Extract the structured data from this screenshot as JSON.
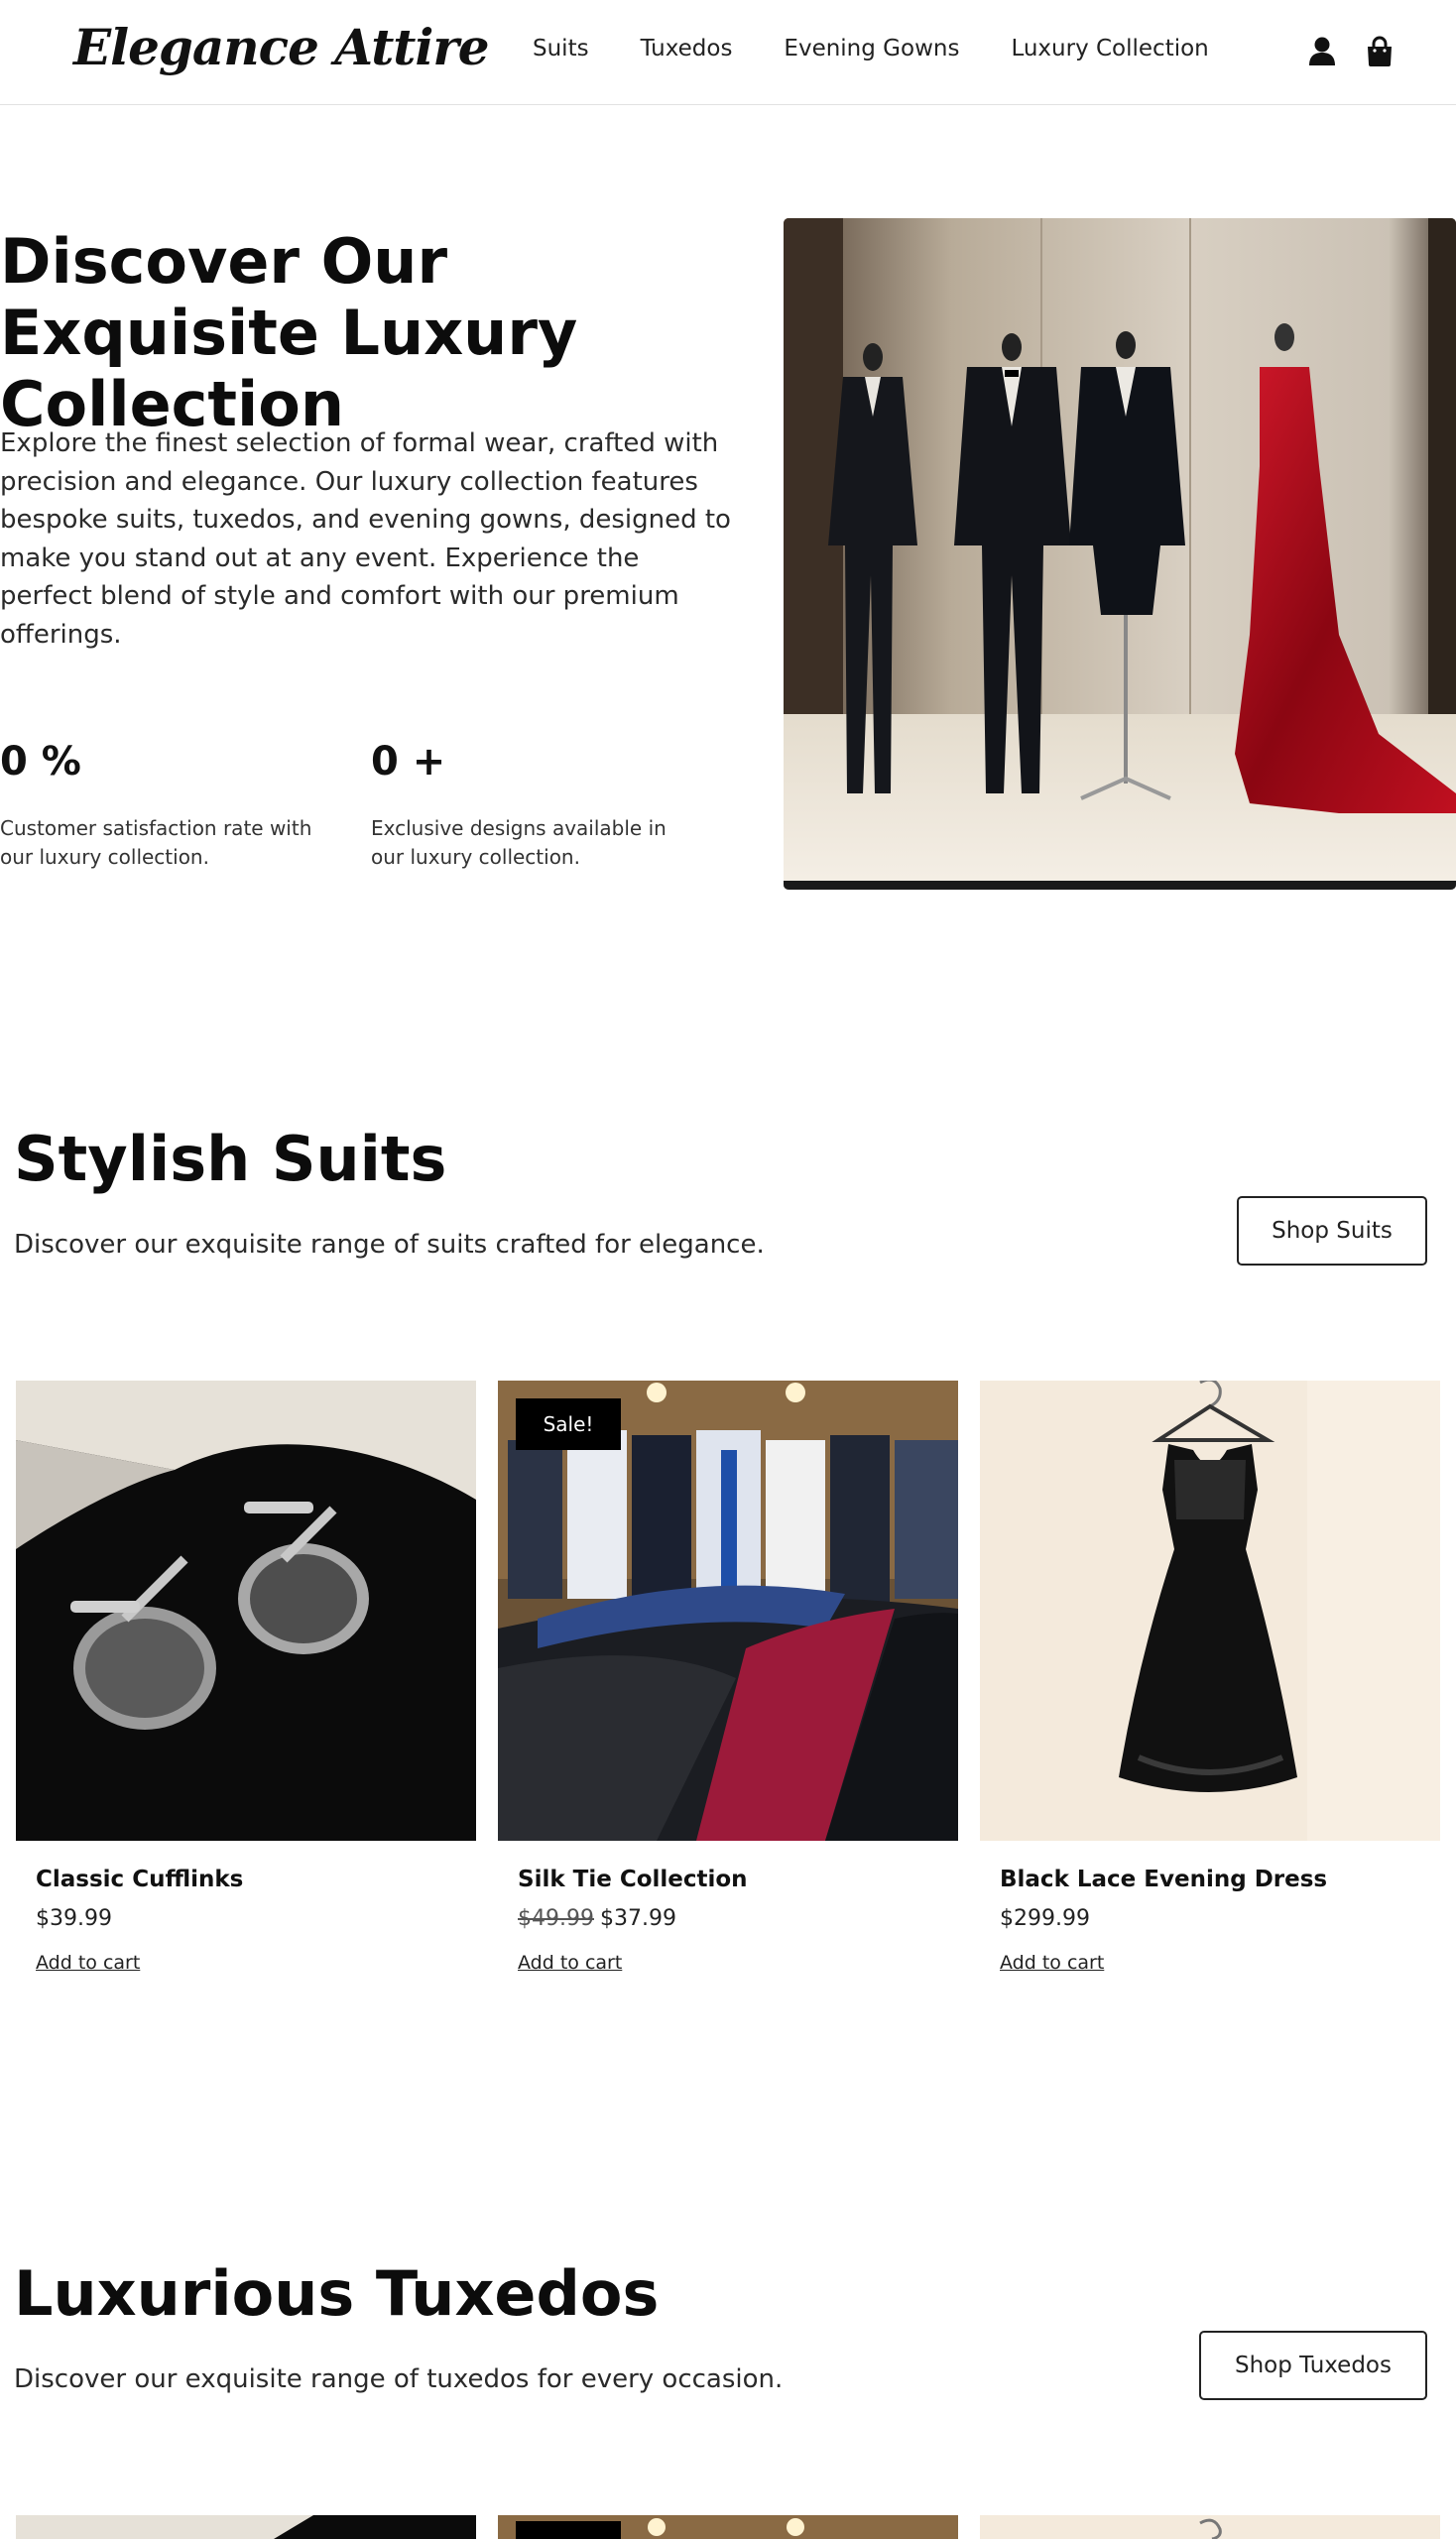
{
  "header": {
    "logo": "Elegance Attire",
    "nav": [
      "Suits",
      "Tuxedos",
      "Evening Gowns",
      "Luxury Collection"
    ],
    "icons": [
      "user-icon",
      "shopping-bag-icon"
    ]
  },
  "hero": {
    "title": "Discover Our Exquisite Luxury Collection",
    "text": "Explore the finest selection of formal wear, crafted with precision and elegance. Our luxury collection features bespoke suits, tuxedos, and evening gowns, designed to make you stand out at any event. Experience the perfect blend of style and comfort with our premium offerings.",
    "stats": [
      {
        "value": "0 %",
        "desc": "Customer satisfaction rate with our luxury collection."
      },
      {
        "value": "0 +",
        "desc": "Exclusive designs available in our luxury collection."
      }
    ]
  },
  "suits": {
    "title": "Stylish Suits",
    "subtitle": "Discover our exquisite range of suits crafted for elegance.",
    "button": "Shop Suits",
    "products": [
      {
        "name": "Classic Cufflinks",
        "price": "$39.99",
        "old_price": "",
        "cart": "Add to cart"
      },
      {
        "name": "Silk Tie Collection",
        "price": "$37.99",
        "old_price": "$49.99",
        "badge": "Sale!",
        "cart": "Add to cart"
      },
      {
        "name": "Black Lace Evening Dress",
        "price": "$299.99",
        "old_price": "",
        "cart": "Add to cart"
      }
    ]
  },
  "tuxedos": {
    "title": "Luxurious Tuxedos",
    "subtitle": "Discover our exquisite range of tuxedos for every occasion.",
    "button": "Shop Tuxedos"
  }
}
